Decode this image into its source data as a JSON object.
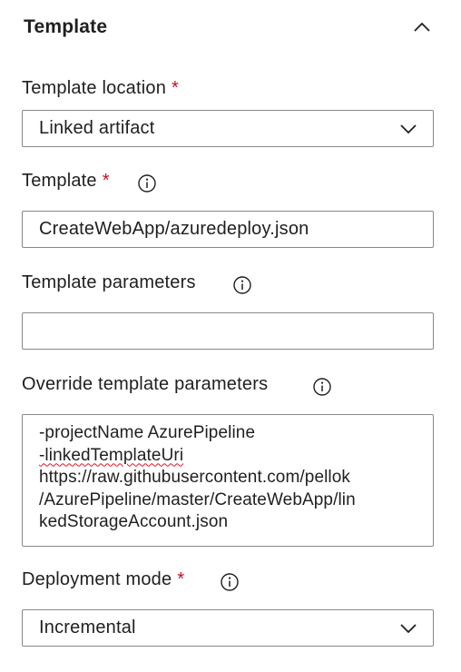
{
  "section": {
    "title": "Template",
    "collapse_icon": "chevron-up-icon"
  },
  "template_location": {
    "label": "Template location",
    "required": "*",
    "value": "Linked artifact",
    "dropdown_icon": "chevron-down-icon"
  },
  "template": {
    "label": "Template",
    "required": "*",
    "info_icon": "info-icon",
    "value": "CreateWebApp/azuredeploy.json"
  },
  "template_parameters": {
    "label": "Template parameters",
    "info_icon": "info-icon",
    "value": ""
  },
  "override_parameters": {
    "label": "Override template parameters",
    "info_icon": "info-icon",
    "lines": [
      "-projectName AzurePipeline",
      "-linkedTemplateUri",
      "https://raw.githubusercontent.com/pellok",
      "/AzurePipeline/master/CreateWebApp/lin",
      "kedStorageAccount.json"
    ]
  },
  "deployment_mode": {
    "label": "Deployment mode",
    "required": "*",
    "info_icon": "info-icon",
    "value": "Incremental",
    "dropdown_icon": "chevron-down-icon"
  },
  "colors": {
    "required": "#c50f1f",
    "border": "#8a8886",
    "text": "#201f1e",
    "spellcheck": "#e81123"
  }
}
